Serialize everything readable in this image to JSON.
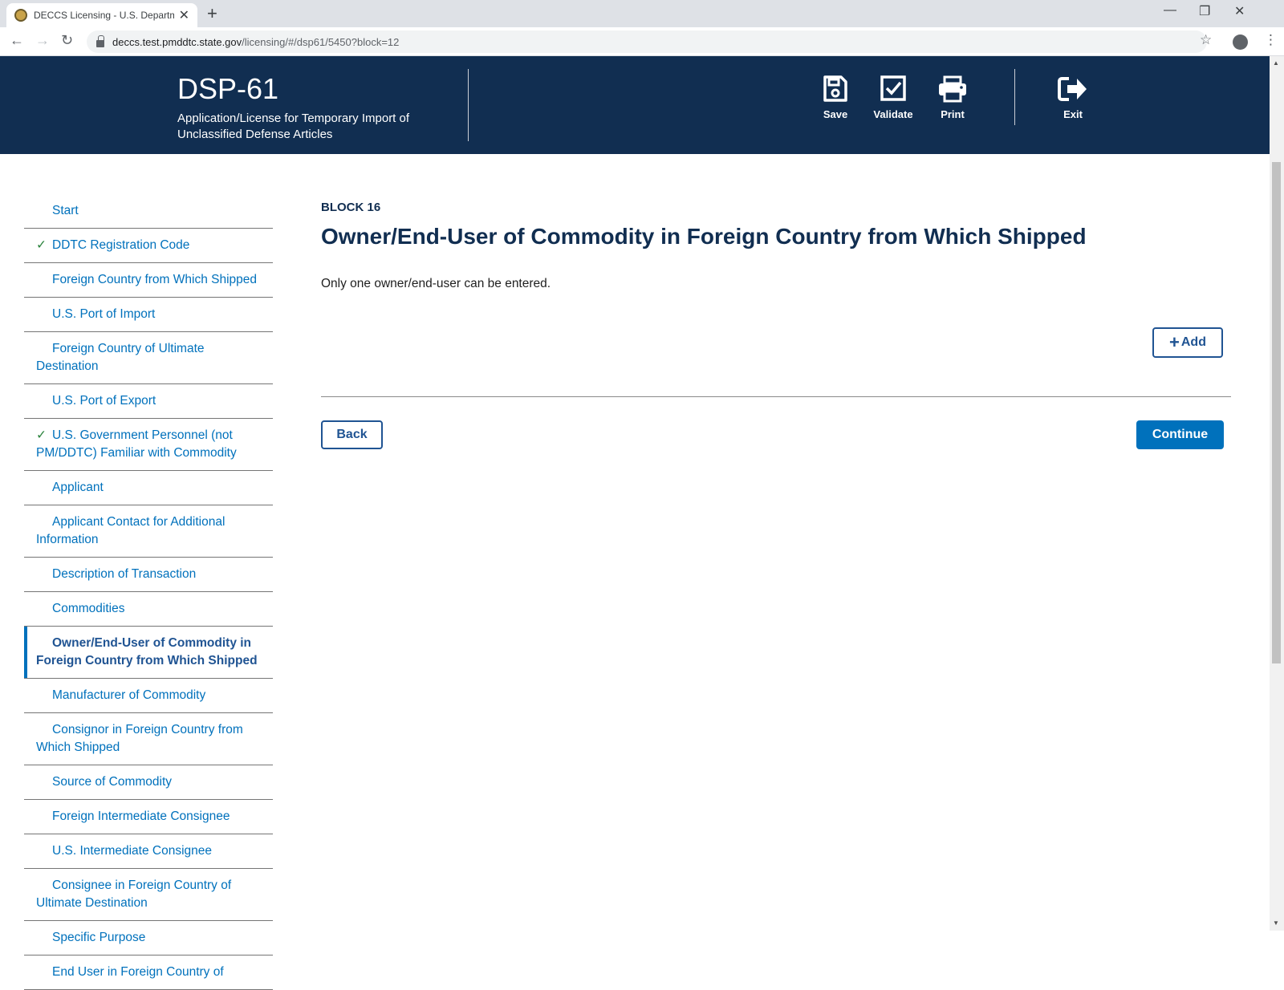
{
  "browser": {
    "tab_title": "DECCS Licensing - U.S. Department",
    "url_domain": "deccs.test.pmddtc.state.gov",
    "url_path": "/licensing/#/dsp61/5450?block=12"
  },
  "header": {
    "form_code": "DSP-61",
    "form_subtitle": "Application/License for Temporary Import of Unclassified Defense Articles",
    "actions": {
      "save": "Save",
      "validate": "Validate",
      "print": "Print",
      "exit": "Exit"
    }
  },
  "sidebar": {
    "items": [
      {
        "label": "Start",
        "indicator": ""
      },
      {
        "label": "DDTC Registration Code",
        "indicator": "✓"
      },
      {
        "label": "Foreign Country from Which Shipped",
        "indicator": ""
      },
      {
        "label": "U.S. Port of Import",
        "indicator": ""
      },
      {
        "label": "Foreign Country of Ultimate Destination",
        "indicator": ""
      },
      {
        "label": "U.S. Port of Export",
        "indicator": ""
      },
      {
        "label": "U.S. Government Personnel (not PM/DDTC) Familiar with Commodity",
        "indicator": "✓"
      },
      {
        "label": "Applicant",
        "indicator": ""
      },
      {
        "label": "Applicant Contact for Additional Information",
        "indicator": ""
      },
      {
        "label": "Description of Transaction",
        "indicator": ""
      },
      {
        "label": "Commodities",
        "indicator": ""
      },
      {
        "label": "Owner/End-User of Commodity in Foreign Country from Which Shipped",
        "indicator": ""
      },
      {
        "label": "Manufacturer of Commodity",
        "indicator": ""
      },
      {
        "label": "Consignor in Foreign Country from Which Shipped",
        "indicator": ""
      },
      {
        "label": "Source of Commodity",
        "indicator": ""
      },
      {
        "label": "Foreign Intermediate Consignee",
        "indicator": ""
      },
      {
        "label": "U.S. Intermediate Consignee",
        "indicator": ""
      },
      {
        "label": "Consignee in Foreign Country of Ultimate Destination",
        "indicator": ""
      },
      {
        "label": "Specific Purpose",
        "indicator": ""
      },
      {
        "label": "End User in Foreign Country of",
        "indicator": ""
      }
    ],
    "active_index": 11
  },
  "main": {
    "block_label": "BLOCK 16",
    "title": "Owner/End-User of Commodity in Foreign Country from Which Shipped",
    "description": "Only one owner/end-user can be entered.",
    "add_label": "Add",
    "back_label": "Back",
    "continue_label": "Continue"
  },
  "colors": {
    "header_bg": "#112e51",
    "link": "#0071bc",
    "primary_button": "#0071bc",
    "check": "#2e8540"
  }
}
